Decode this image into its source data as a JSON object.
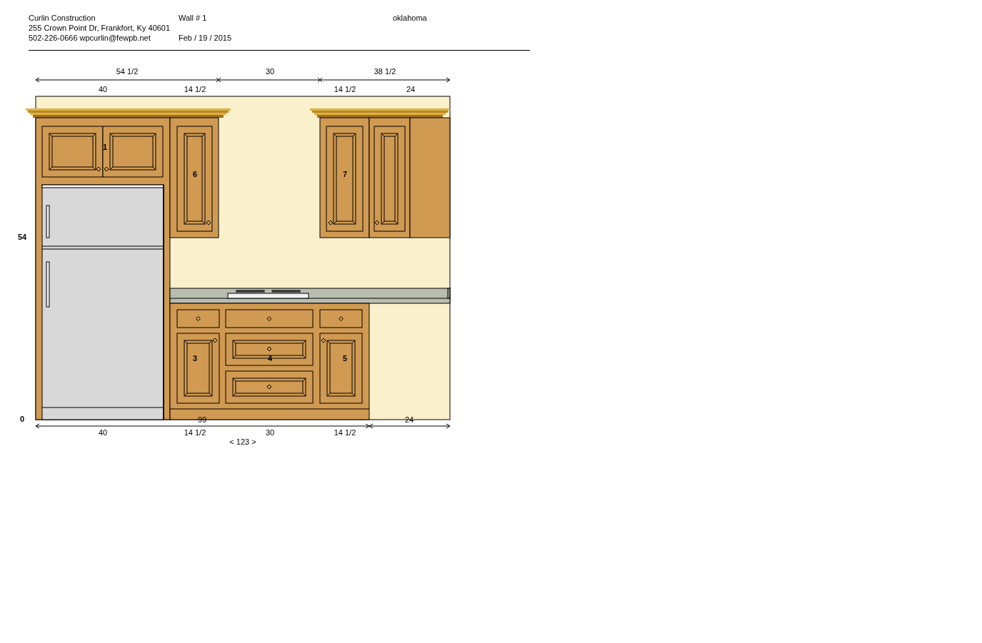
{
  "header": {
    "company": "Curlin Construction",
    "address": "255 Crown Point Dr, Frankfort, Ky 40601",
    "contact": "502-226-0666 wpcurlin@fewpb.net",
    "wall": "Wall # 1",
    "date": "Feb / 19 / 2015",
    "location": "oklahoma"
  },
  "drawing": {
    "top_overall": [
      "54 1/2",
      "30",
      "38 1/2"
    ],
    "top_segments": [
      "40",
      "14 1/2",
      "14 1/2",
      "24"
    ],
    "height_marks": [
      "54",
      "0"
    ],
    "cabinet_numbers": [
      "1",
      "6",
      "7",
      "3",
      "4",
      "5"
    ],
    "base_run": "99",
    "open_run": "24",
    "bottom_segments": [
      "40",
      "14 1/2",
      "30",
      "14 1/2"
    ],
    "total": "< 123 >"
  }
}
